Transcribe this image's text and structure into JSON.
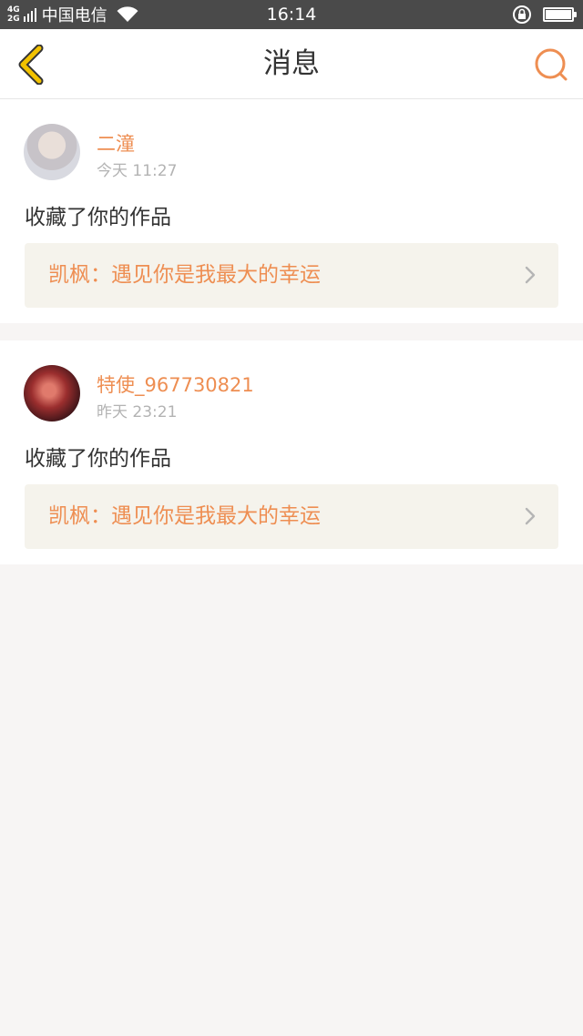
{
  "status_bar": {
    "network_top": "4G",
    "network_bottom": "2G",
    "carrier": "中国电信",
    "time": "16:14"
  },
  "navbar": {
    "title": "消息",
    "accent_color": "#ee8e52",
    "back_icon_color": "#f2c200"
  },
  "messages": [
    {
      "username": "二潼",
      "time": "今天 11:27",
      "action": "收藏了你的作品",
      "work": "凯枫：遇见你是我最大的幸运"
    },
    {
      "username": "特使_967730821",
      "time": "昨天 23:21",
      "action": "收藏了你的作品",
      "work": "凯枫：遇见你是我最大的幸运"
    }
  ]
}
